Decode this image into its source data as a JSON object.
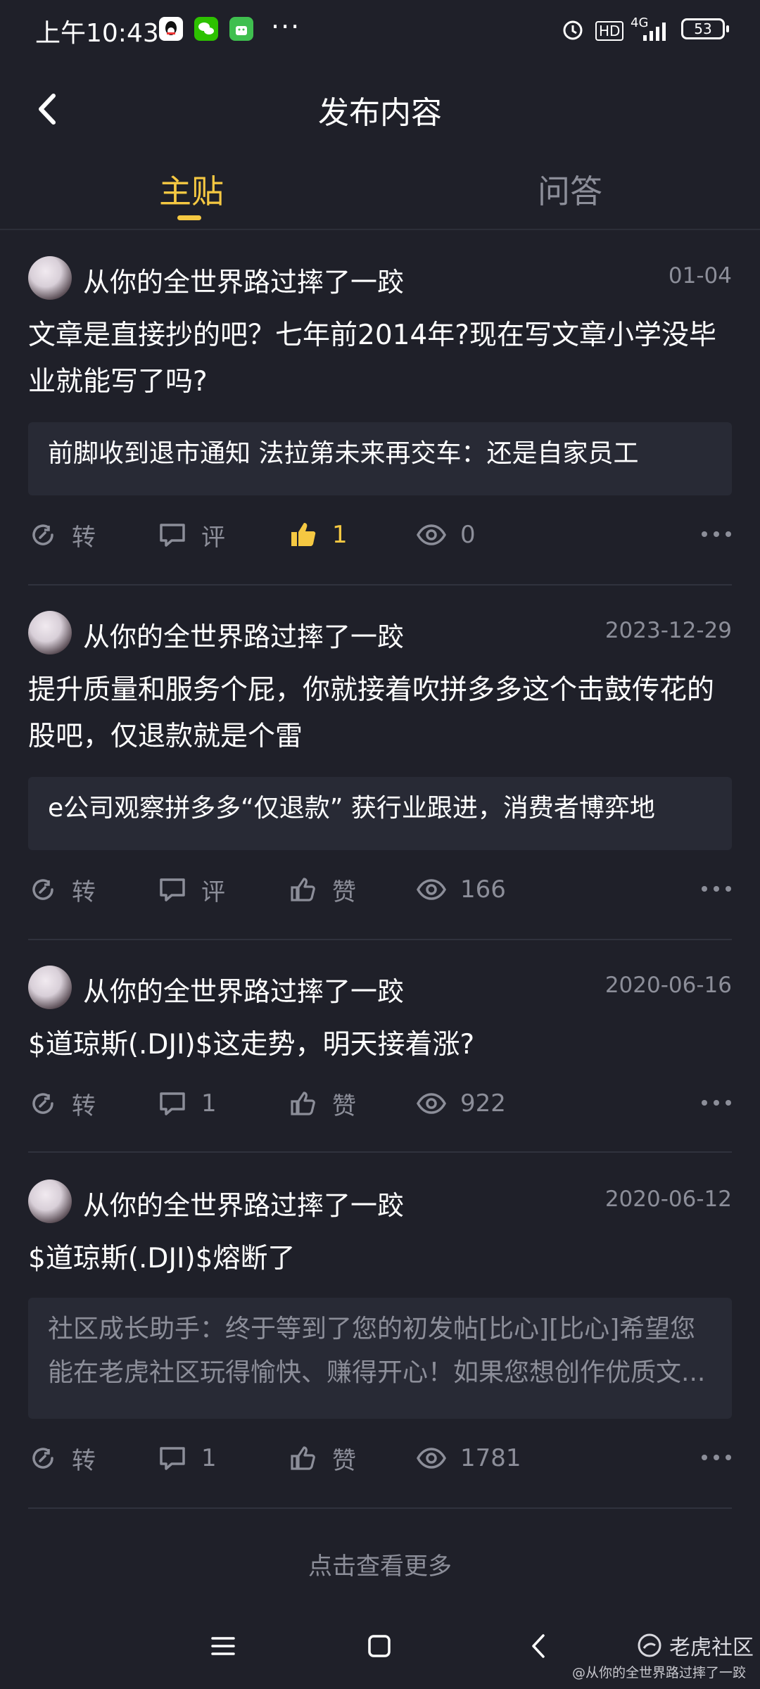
{
  "status_bar": {
    "time": "上午10:43",
    "apps": [
      "qq-icon",
      "wechat-icon",
      "android-icon"
    ],
    "more": "···",
    "network": "4G",
    "hd": "HD",
    "battery": "53"
  },
  "header": {
    "title": "发布内容"
  },
  "tabs": [
    {
      "label": "主贴",
      "active": true
    },
    {
      "label": "问答",
      "active": false
    }
  ],
  "posts": [
    {
      "author": "从你的全世界路过摔了一跤",
      "date": "01-04",
      "content": "文章是直接抄的吧？七年前2014年?现在写文章小学没毕业就能写了吗?",
      "quote": "前脚收到退市通知 法拉第未来再交车：还是自家员工",
      "actions": {
        "repost": "转",
        "comment": "评",
        "like": "1",
        "views": "0"
      }
    },
    {
      "author": "从你的全世界路过摔了一跤",
      "date": "2023-12-29",
      "content": "提升质量和服务个屁，你就接着吹拼多多这个击鼓传花的股吧，仅退款就是个雷",
      "quote": "e公司观察拼多多“仅退款” 获行业跟进，消费者博弈地",
      "actions": {
        "repost": "转",
        "comment": "评",
        "like": "赞",
        "views": "166"
      }
    },
    {
      "author": "从你的全世界路过摔了一跤",
      "date": "2020-06-16",
      "content": "$道琼斯(.DJI)$这走势，明天接着涨?",
      "actions": {
        "repost": "转",
        "comment": "1",
        "like": "赞",
        "views": "922"
      }
    },
    {
      "author": "从你的全世界路过摔了一跤",
      "date": "2020-06-12",
      "content": "$道琼斯(.DJI)$熔断了",
      "quote": "社区成长助手：终于等到了您的初发帖[比心][比心]希望您能在老虎社区玩得愉快、赚得开心！如果您想创作优质文...",
      "actions": {
        "repost": "转",
        "comment": "1",
        "like": "赞",
        "views": "1781"
      }
    }
  ],
  "load_more": "点击查看更多",
  "watermark": {
    "brand": "老虎社区",
    "user": "@从你的全世界路过摔了一跤"
  },
  "colors": {
    "background": "#1f2029",
    "accent": "#f5c842",
    "muted": "#8c8e99"
  }
}
